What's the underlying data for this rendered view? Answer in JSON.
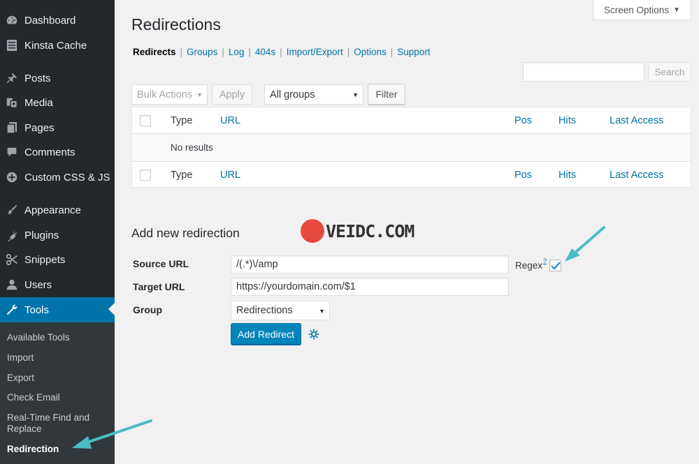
{
  "sidebar": {
    "items": [
      {
        "label": "Dashboard",
        "icon": "dashboard-icon"
      },
      {
        "label": "Kinsta Cache",
        "icon": "kinsta-cache-icon"
      },
      {
        "label": "Posts",
        "icon": "pin-icon"
      },
      {
        "label": "Media",
        "icon": "media-icon"
      },
      {
        "label": "Pages",
        "icon": "pages-icon"
      },
      {
        "label": "Comments",
        "icon": "comments-icon"
      },
      {
        "label": "Custom CSS & JS",
        "icon": "plus-circle-icon"
      },
      {
        "label": "Appearance",
        "icon": "paintbrush-icon"
      },
      {
        "label": "Plugins",
        "icon": "plugins-icon"
      },
      {
        "label": "Snippets",
        "icon": "scissors-icon"
      },
      {
        "label": "Users",
        "icon": "user-icon"
      },
      {
        "label": "Tools",
        "icon": "wrench-icon",
        "active": true
      }
    ],
    "submenu": [
      {
        "label": "Available Tools"
      },
      {
        "label": "Import"
      },
      {
        "label": "Export"
      },
      {
        "label": "Check Email"
      },
      {
        "label": "Real-Time Find and Replace"
      },
      {
        "label": "Redirection",
        "current": true
      }
    ]
  },
  "screen_options": {
    "label": "Screen Options"
  },
  "page": {
    "title": "Redirections"
  },
  "tabs": [
    {
      "label": "Redirects",
      "current": true
    },
    {
      "label": "Groups"
    },
    {
      "label": "Log"
    },
    {
      "label": "404s"
    },
    {
      "label": "Import/Export"
    },
    {
      "label": "Options"
    },
    {
      "label": "Support"
    }
  ],
  "search": {
    "value": "",
    "button_label": "Search"
  },
  "toolbar": {
    "bulk_actions": "Bulk Actions",
    "apply_label": "Apply",
    "group_filter": "All groups",
    "filter_label": "Filter"
  },
  "table": {
    "columns": {
      "type": "Type",
      "url": "URL",
      "pos": "Pos",
      "hits": "Hits",
      "last_access": "Last Access"
    },
    "empty_message": "No results"
  },
  "add_new": {
    "title": "Add new redirection",
    "source_label": "Source URL",
    "source_value": "/(.*)\\/amp",
    "target_label": "Target URL",
    "target_value": "https://yourdomain.com/$1",
    "group_label": "Group",
    "group_value": "Redirections",
    "regex_label": "Regex",
    "regex_help": "?",
    "regex_checked": true,
    "submit_label": "Add Redirect"
  },
  "watermark": {
    "text": "VEIDC.COM"
  },
  "colors": {
    "sidebar_bg": "#23282d",
    "submenu_bg": "#32373c",
    "accent": "#0073aa",
    "primary_button": "#0085ba",
    "annotation_arrow": "#4bbcc4"
  }
}
